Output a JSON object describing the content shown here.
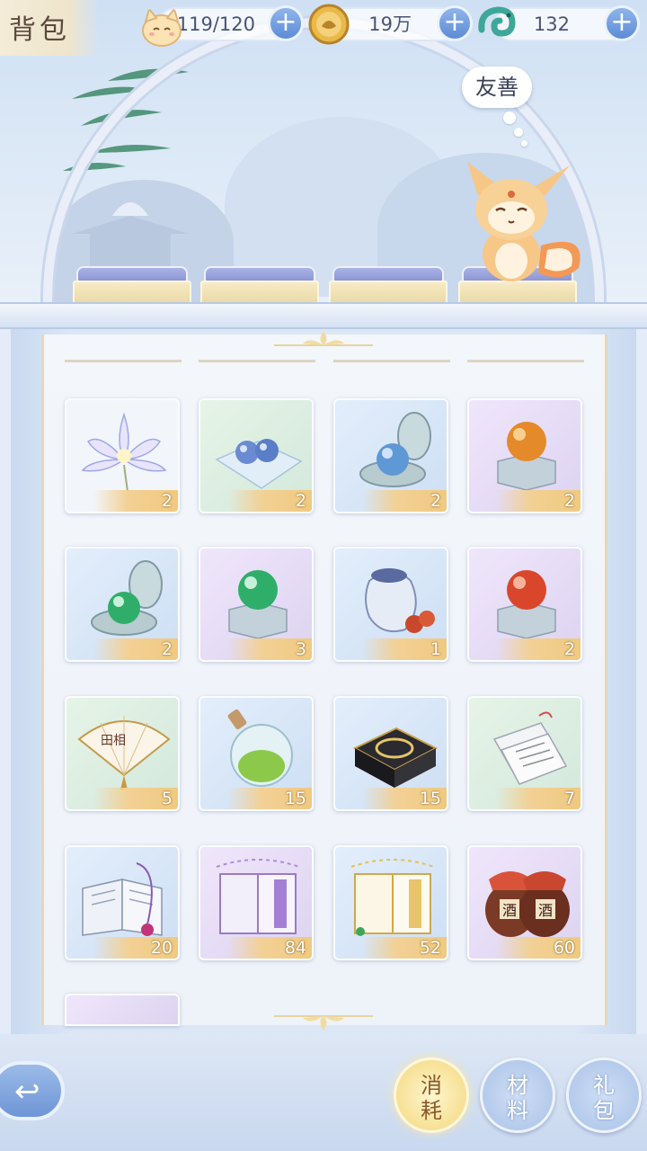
{
  "header": {
    "title": "背包"
  },
  "resources": [
    {
      "name": "stamina",
      "icon": "cat-face-icon",
      "value": "119/120"
    },
    {
      "name": "coins",
      "icon": "gold-coin-icon",
      "value": "19万"
    },
    {
      "name": "jade",
      "icon": "jade-dragon-icon",
      "value": "132"
    }
  ],
  "pet": {
    "mood": "友善"
  },
  "inventory": {
    "items": [
      {
        "icon": "lotus-flower-icon",
        "count": "2",
        "bg": "purple"
      },
      {
        "icon": "blue-pearls-on-cloth-icon",
        "count": "2",
        "bg": "green"
      },
      {
        "icon": "blue-pearl-box-icon",
        "count": "2",
        "bg": "blue"
      },
      {
        "icon": "orange-orb-box-icon",
        "count": "2",
        "bg": "purple"
      },
      {
        "icon": "green-pearl-box-icon",
        "count": "2",
        "bg": "blue"
      },
      {
        "icon": "green-orb-box-icon",
        "count": "3",
        "bg": "purple"
      },
      {
        "icon": "pouch-with-beads-icon",
        "count": "1",
        "bg": "blue"
      },
      {
        "icon": "red-orb-box-icon",
        "count": "2",
        "bg": "purple"
      },
      {
        "icon": "folding-fan-icon",
        "count": "5",
        "bg": "green"
      },
      {
        "icon": "green-potion-bottle-icon",
        "count": "15",
        "bg": "blue"
      },
      {
        "icon": "black-gift-box-icon",
        "count": "15",
        "bg": "blue"
      },
      {
        "icon": "paper-letters-icon",
        "count": "7",
        "bg": "green"
      },
      {
        "icon": "open-book-icon",
        "count": "20",
        "bg": "blue"
      },
      {
        "icon": "purple-music-book-icon",
        "count": "84",
        "bg": "purple"
      },
      {
        "icon": "gold-music-book-icon",
        "count": "52",
        "bg": "blue"
      },
      {
        "icon": "wine-jars-icon",
        "count": "60",
        "bg": "purple"
      }
    ]
  },
  "tabs": [
    {
      "label": "消耗",
      "active": true
    },
    {
      "label": "材料",
      "active": false
    },
    {
      "label": "礼包",
      "active": false
    }
  ],
  "colors": {
    "accent": "#5d8bd6",
    "count_gold": "#f0c97f",
    "active_tab": "#f3d77a"
  }
}
